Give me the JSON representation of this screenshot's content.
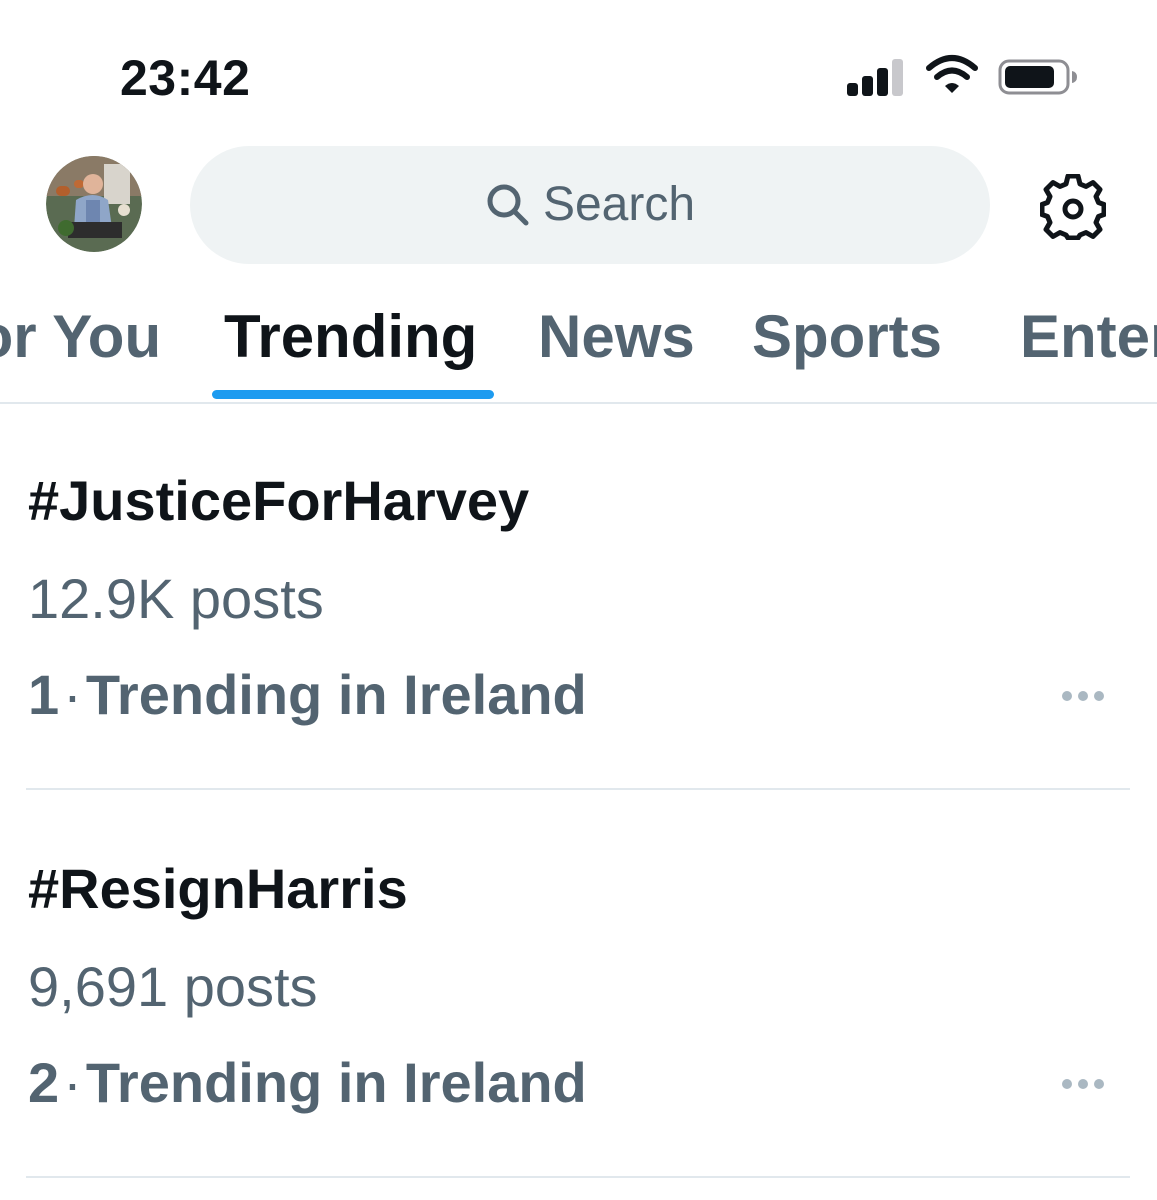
{
  "status_bar": {
    "time": "23:42",
    "signal_icon": "cellular-signal-icon",
    "wifi_icon": "wifi-icon",
    "battery_icon": "battery-icon"
  },
  "header": {
    "avatar_icon": "profile-avatar",
    "search": {
      "icon": "search-icon",
      "placeholder": "Search"
    },
    "settings_icon": "gear-icon"
  },
  "tabs": [
    {
      "label": "For You",
      "active": false
    },
    {
      "label": "Trending",
      "active": true
    },
    {
      "label": "News",
      "active": false
    },
    {
      "label": "Sports",
      "active": false
    },
    {
      "label": "Entertainment",
      "active": false
    }
  ],
  "trends": [
    {
      "name": "#JusticeForHarvey",
      "posts": "12.9K posts",
      "rank": "1",
      "separator": "·",
      "context": "Trending in Ireland"
    },
    {
      "name": "#ResignHarris",
      "posts": "9,691 posts",
      "rank": "2",
      "separator": "·",
      "context": "Trending in Ireland"
    }
  ],
  "colors": {
    "accent": "#1d9bf0",
    "text_primary": "#0f1419",
    "text_secondary": "#536471",
    "search_bg": "#eff3f4",
    "divider": "#e1e8ed"
  }
}
